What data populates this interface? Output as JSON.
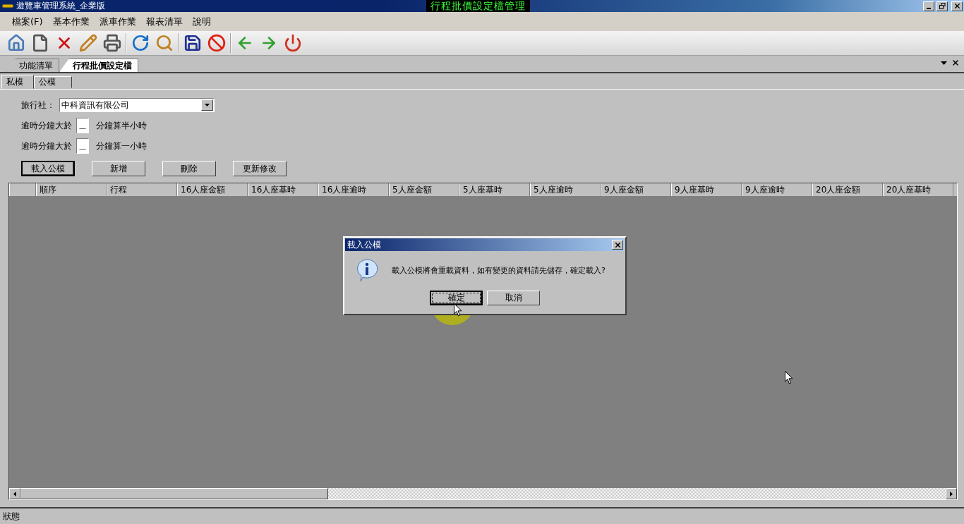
{
  "title_bar": {
    "title": "遊覽車管理系統_企業版",
    "caption": "行程批價設定檔管理"
  },
  "menu": [
    "檔案(F)",
    "基本作業",
    "派車作業",
    "報表清單",
    "說明"
  ],
  "doc_tabs": [
    {
      "label": "功能清單",
      "selected": false
    },
    {
      "label": "行程批價設定檔",
      "selected": true
    }
  ],
  "sub_tabs": [
    {
      "label": "私模",
      "selected": true
    },
    {
      "label": "公模",
      "selected": false
    }
  ],
  "form": {
    "agency": {
      "label": "旅行社：",
      "value": "中科資訊有限公司"
    },
    "overtime": [
      {
        "label": "逾時分鐘大於",
        "value": "__",
        "suffix": "分鐘算半小時"
      },
      {
        "label": "逾時分鐘大於",
        "value": "__",
        "suffix": "分鐘算一小時"
      }
    ],
    "buttons": [
      {
        "label": "載入公模",
        "default": true
      },
      {
        "label": "新增",
        "default": false
      },
      {
        "label": "刪除",
        "default": false
      },
      {
        "label": "更新修改",
        "default": false
      }
    ]
  },
  "table": {
    "columns": [
      "順序",
      "行程",
      "16人座金額",
      "16人座基時",
      "16人座逾時",
      "5人座金額",
      "5人座基時",
      "5人座逾時",
      "9人座金額",
      "9人座基時",
      "9人座逾時",
      "20人座金額",
      "20人座基時"
    ]
  },
  "dialog": {
    "title": "載入公模",
    "message": "載入公模將會重載資料，如有變更的資料請先儲存，確定載入?",
    "buttons": [
      {
        "label": "確定",
        "focused": true
      },
      {
        "label": "取消",
        "focused": false
      }
    ]
  },
  "status_bar": "狀態"
}
